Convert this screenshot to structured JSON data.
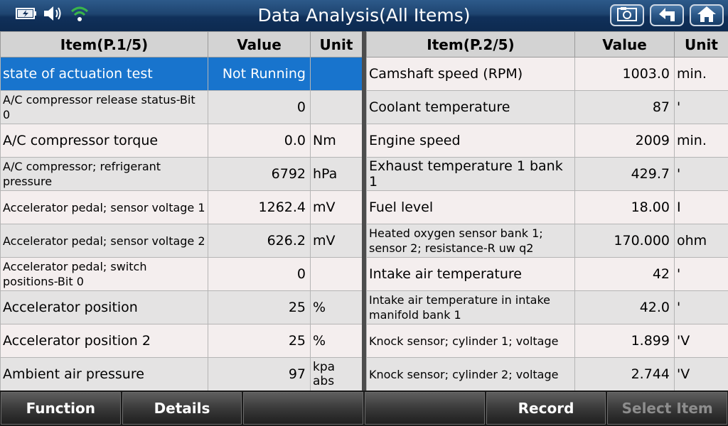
{
  "header": {
    "title": "Data Analysis(All Items)",
    "icons": [
      "battery-charging-icon",
      "speaker-icon",
      "wifi-icon"
    ],
    "buttons": [
      "screenshot-icon",
      "back-icon",
      "home-icon"
    ]
  },
  "left_table": {
    "columns": [
      "Item(P.1/5)",
      "Value",
      "Unit"
    ],
    "rows": [
      {
        "item": "state of actuation test",
        "value": "Not Running",
        "unit": "",
        "selected": true
      },
      {
        "item": "A/C compressor release status-Bit 0",
        "value": "0",
        "unit": ""
      },
      {
        "item": "A/C compressor torque",
        "value": "0.0",
        "unit": "Nm"
      },
      {
        "item": "A/C compressor; refrigerant pressure",
        "value": "6792",
        "unit": "hPa"
      },
      {
        "item": "Accelerator pedal; sensor voltage 1",
        "value": "1262.4",
        "unit": "mV"
      },
      {
        "item": "Accelerator pedal; sensor voltage 2",
        "value": "626.2",
        "unit": "mV"
      },
      {
        "item": "Accelerator pedal; switch positions-Bit 0",
        "value": "0",
        "unit": ""
      },
      {
        "item": "Accelerator position",
        "value": "25",
        "unit": "%"
      },
      {
        "item": "Accelerator position 2",
        "value": "25",
        "unit": "%"
      },
      {
        "item": "Ambient air pressure",
        "value": "97",
        "unit": "kpa abs"
      }
    ]
  },
  "right_table": {
    "columns": [
      "Item(P.2/5)",
      "Value",
      "Unit"
    ],
    "rows": [
      {
        "item": "Camshaft speed (RPM)",
        "value": "1003.0",
        "unit": "min."
      },
      {
        "item": "Coolant temperature",
        "value": "87",
        "unit": "'"
      },
      {
        "item": "Engine speed",
        "value": "2009",
        "unit": "min."
      },
      {
        "item": "Exhaust temperature 1 bank 1",
        "value": "429.7",
        "unit": "'"
      },
      {
        "item": "Fuel level",
        "value": "18.00",
        "unit": "I"
      },
      {
        "item": "Heated oxygen sensor bank 1; sensor 2; resistance-R uw q2",
        "value": "170.000",
        "unit": "ohm"
      },
      {
        "item": "Intake air temperature",
        "value": "42",
        "unit": "'"
      },
      {
        "item": "Intake air temperature in intake manifold bank 1",
        "value": "42.0",
        "unit": "'"
      },
      {
        "item": "Knock sensor; cylinder 1; voltage",
        "value": "1.899",
        "unit": "'V"
      },
      {
        "item": "Knock sensor; cylinder 2; voltage",
        "value": "2.744",
        "unit": "'V"
      }
    ]
  },
  "footer": {
    "buttons": [
      {
        "label": "Function",
        "enabled": true
      },
      {
        "label": "Details",
        "enabled": true
      },
      {
        "label": "",
        "enabled": true
      },
      {
        "label": "",
        "enabled": true
      },
      {
        "label": "Record",
        "enabled": true
      },
      {
        "label": "Select Item",
        "enabled": false
      }
    ]
  },
  "colors": {
    "selected_row": "#1874cd",
    "title_bar": "#1e4470"
  }
}
